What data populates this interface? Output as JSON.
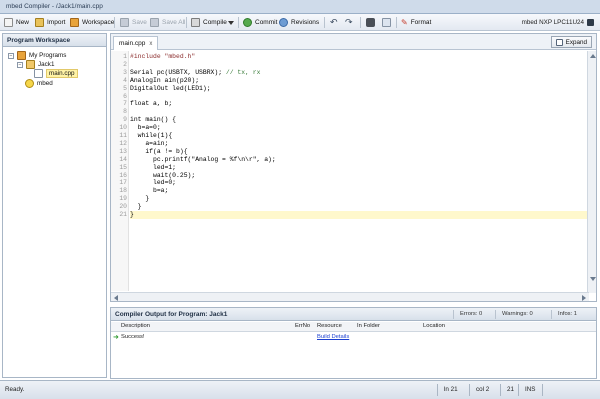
{
  "window": {
    "title": "mbed Compiler - /Jack1/main.cpp"
  },
  "toolbar": {
    "new": "New",
    "import": "Import",
    "workspace": "Workspace",
    "save": "Save",
    "save_all": "Save All",
    "compile": "Compile",
    "commit": "Commit",
    "revisions": "Revisions",
    "format": "Format",
    "target": "mbed NXP LPC11U24"
  },
  "workspace": {
    "title": "Program Workspace",
    "root": "My Programs",
    "program": "Jack1",
    "file": "main.cpp",
    "library": "mbed"
  },
  "editor": {
    "tab_label": "main.cpp",
    "tab_close": "x",
    "expand_label": "Expand",
    "current_line": 21,
    "lines": [
      {
        "n": "1",
        "text": "#include \"mbed.h\""
      },
      {
        "n": "2",
        "text": ""
      },
      {
        "n": "3",
        "text": "Serial pc(USBTX, USBRX); // tx, rx"
      },
      {
        "n": "4",
        "text": "AnalogIn ain(p20);"
      },
      {
        "n": "5",
        "text": "DigitalOut led(LED1);"
      },
      {
        "n": "6",
        "text": ""
      },
      {
        "n": "7",
        "text": "float a, b;"
      },
      {
        "n": "8",
        "text": ""
      },
      {
        "n": "9",
        "text": "int main() {"
      },
      {
        "n": "10",
        "text": "  b=a=0;"
      },
      {
        "n": "11",
        "text": "  while(1){"
      },
      {
        "n": "12",
        "text": "    a=ain;"
      },
      {
        "n": "13",
        "text": "    if(a != b){"
      },
      {
        "n": "14",
        "text": "      pc.printf(\"Analog = %f\\n\\r\", a);"
      },
      {
        "n": "15",
        "text": "      led=1;"
      },
      {
        "n": "16",
        "text": "      wait(0.25);"
      },
      {
        "n": "17",
        "text": "      led=0;"
      },
      {
        "n": "18",
        "text": "      b=a;"
      },
      {
        "n": "19",
        "text": "    }"
      },
      {
        "n": "20",
        "text": "  }"
      },
      {
        "n": "21",
        "text": "}"
      }
    ]
  },
  "output": {
    "title": "Compiler Output for Program: Jack1",
    "errors": "Errors: 0",
    "warnings": "Warnings: 0",
    "infos": "Infos: 1",
    "columns": [
      "Description",
      "ErrNo",
      "Resource",
      "In Folder",
      "Location"
    ],
    "rows": [
      {
        "description": "Success!",
        "errno": "",
        "resource": "Build Details",
        "folder": "",
        "location": ""
      }
    ]
  },
  "status": {
    "text": "Ready.",
    "line": "ln 21",
    "col": "col 2",
    "pos": "21",
    "mode": "INS"
  },
  "colors": {
    "accent": "#cfdbea",
    "link": "#1a3fd1",
    "current_line": "#fff8cc"
  }
}
